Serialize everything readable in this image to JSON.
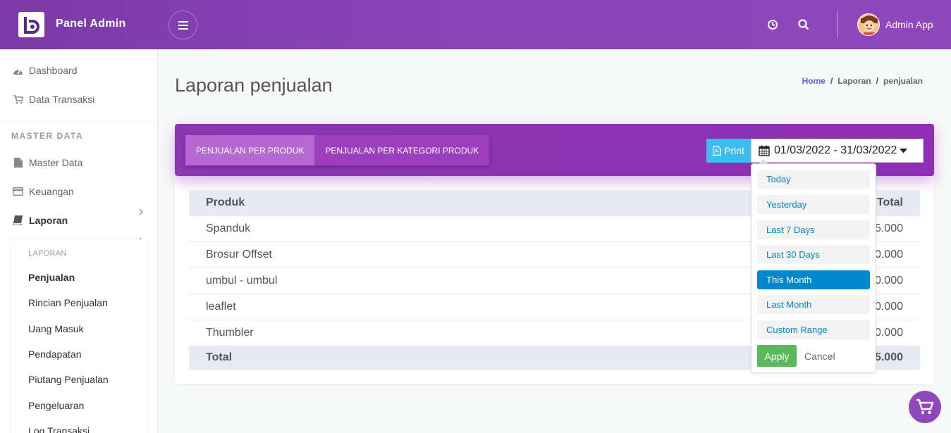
{
  "header": {
    "brand": "Panel Admin",
    "user_name": "Admin App",
    "icons": [
      "menu-icon",
      "clock-icon",
      "search-icon",
      "avatar"
    ],
    "bg_color": "#8b44b7"
  },
  "sidebar": {
    "items": [
      {
        "label": "Dashboard",
        "icon": "dashboard-icon"
      },
      {
        "label": "Data Transaksi",
        "icon": "cart-icon"
      }
    ],
    "section_title": "MASTER DATA",
    "master_items": [
      {
        "label": "Master Data",
        "icon": "file-icon"
      },
      {
        "label": "Keuangan",
        "icon": "card-icon"
      },
      {
        "label": "Laporan",
        "icon": "book-icon"
      }
    ],
    "submenu": {
      "title": "LAPORAN",
      "items": [
        "Penjualan",
        "Rincian Penjualan",
        "Uang Masuk",
        "Pendapatan",
        "Piutang Penjualan",
        "Pengeluaran",
        "Log Transaksi"
      ],
      "active": "Penjualan"
    }
  },
  "page": {
    "title": "Laporan penjualan",
    "breadcrumb": [
      "Home",
      "Laporan",
      "penjualan"
    ]
  },
  "tabs": [
    {
      "label": "PENJUALAN PER PRODUK",
      "active": true
    },
    {
      "label": "PENJUALAN PER KATEGORI PRODUK",
      "active": false
    }
  ],
  "toolbar": {
    "print_label": "Print",
    "date_range": "01/03/2022 - 31/03/2022"
  },
  "table": {
    "headers": [
      "Produk",
      "Total"
    ],
    "rows": [
      {
        "produk": "Spanduk",
        "total": "5.000"
      },
      {
        "produk": "Brosur Offset",
        "total": "0.000"
      },
      {
        "produk": "umbul - umbul",
        "total": "0.000"
      },
      {
        "produk": "leaflet",
        "total": "0.000"
      },
      {
        "produk": "Thumbler",
        "total": "0.000"
      }
    ],
    "footer": {
      "label": "Total",
      "total": "5.000"
    }
  },
  "daterange": {
    "ranges": [
      "Today",
      "Yesterday",
      "Last 7 Days",
      "Last 30 Days",
      "This Month",
      "Last Month",
      "Custom Range"
    ],
    "active": "This Month",
    "apply_label": "Apply",
    "cancel_label": "Cancel"
  }
}
